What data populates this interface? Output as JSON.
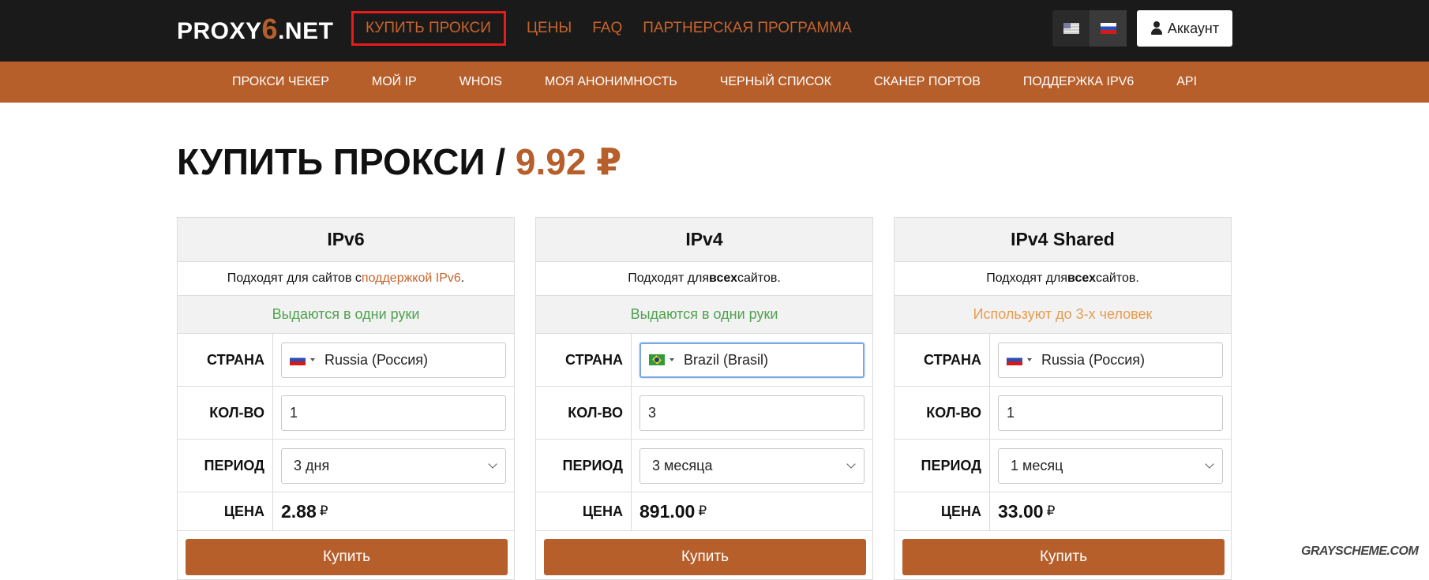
{
  "logo": {
    "pre": "PROXY",
    "six": "6",
    "post": ".NET"
  },
  "topnav": [
    "КУПИТЬ ПРОКСИ",
    "ЦЕНЫ",
    "FAQ",
    "ПАРТНЕРСКАЯ ПРОГРАММА"
  ],
  "account_label": "Аккаунт",
  "subnav": [
    "ПРОКСИ ЧЕКЕР",
    "МОЙ IP",
    "WHOIS",
    "МОЯ АНОНИМНОСТЬ",
    "ЧЕРНЫЙ СПИСОК",
    "СКАНЕР ПОРТОВ",
    "ПОДДЕРЖКА IPV6",
    "API"
  ],
  "title": {
    "main": "КУПИТЬ ПРОКСИ / ",
    "price": "9.92 ₽"
  },
  "labels": {
    "country": "СТРАНА",
    "qty": "КОЛ-ВО",
    "period": "ПЕРИОД",
    "price": "ЦЕНА",
    "buy": "Купить",
    "currency": "₽"
  },
  "cards": [
    {
      "name": "IPv6",
      "desc_pre": "Подходят для сайтов с ",
      "desc_bold": "",
      "desc_link": "поддержкой IPv6",
      "desc_post": ".",
      "badge": "Выдаются в одни руки",
      "country": "Russia (Россия)",
      "qty": "1",
      "period": "3 дня",
      "price": "2.88"
    },
    {
      "name": "IPv4",
      "desc_pre": "Подходят для ",
      "desc_bold": "всех",
      "desc_link": "",
      "desc_post": " сайтов.",
      "badge": "Выдаются в одни руки",
      "country": "Brazil (Brasil)",
      "qty": "3",
      "period": "3 месяца",
      "price": "891.00"
    },
    {
      "name": "IPv4 Shared",
      "desc_pre": "Подходят для ",
      "desc_bold": "всех",
      "desc_link": "",
      "desc_post": " сайтов.",
      "badge": "Используют до 3-х человек",
      "country": "Russia (Россия)",
      "qty": "1",
      "period": "1 месяц",
      "price": "33.00"
    }
  ],
  "watermark": "GRAYSCHEME.COM"
}
